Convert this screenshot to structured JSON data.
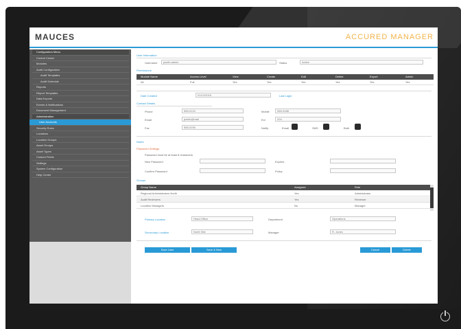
{
  "app": {
    "logo": "MAUCES",
    "title": "ACCURED MANAGER",
    "accent_color": "#2a9ad6",
    "title_color": "#f2b34a"
  },
  "sidebar": {
    "items": [
      {
        "label": "Configuration Menu",
        "kind": "head"
      },
      {
        "label": "Control Center",
        "kind": "normal"
      },
      {
        "label": "Modules",
        "kind": "normal"
      },
      {
        "label": "Audit Configuration",
        "kind": "normal"
      },
      {
        "label": "Audit Templates",
        "kind": "indent"
      },
      {
        "label": "Audit Schedule",
        "kind": "indent"
      },
      {
        "label": "Reports",
        "kind": "normal"
      },
      {
        "label": "Report Templates",
        "kind": "normal"
      },
      {
        "label": "Data Exports",
        "kind": "normal"
      },
      {
        "label": "Events & Notifications",
        "kind": "normal"
      },
      {
        "label": "Document Management",
        "kind": "normal"
      },
      {
        "label": "Administration",
        "kind": "head"
      },
      {
        "label": "User Accounts",
        "kind": "active"
      },
      {
        "label": "Security Roles",
        "kind": "normal"
      },
      {
        "label": "Locations",
        "kind": "normal"
      },
      {
        "label": "Location Groups",
        "kind": "normal"
      },
      {
        "label": "Asset Groups",
        "kind": "normal"
      },
      {
        "label": "Asset Types",
        "kind": "normal"
      },
      {
        "label": "Custom Fields",
        "kind": "normal"
      },
      {
        "label": "Settings",
        "kind": "normal"
      },
      {
        "label": "System Configuration",
        "kind": "normal"
      },
      {
        "label": "Help Center",
        "kind": "normal"
      }
    ]
  },
  "main": {
    "section_title": "User Information",
    "username_label": "Username",
    "username_value": "jsmith.admin",
    "status_label": "Status",
    "status_value": "Active",
    "permissions_label": "Permissions",
    "grid1": {
      "headers": [
        "Module Name",
        "Access Level",
        "View",
        "Create",
        "Edit",
        "Delete",
        "Export",
        "Admin"
      ],
      "rows": [
        [
          "All",
          "Full",
          "Yes",
          "Yes",
          "Yes",
          "Yes",
          "Yes",
          "Yes"
        ]
      ]
    },
    "date_created_label": "Date Created",
    "date_created_value": "01/12/2015",
    "last_login_label": "Last Login",
    "contact_title": "Contact Details",
    "phone_label": "Phone",
    "phone_value": "555-0123",
    "mobile_label": "Mobile",
    "mobile_value": "555-0188",
    "email_label": "Email",
    "email_value": "jsmith@mail",
    "ext_label": "Ext",
    "ext_value": "204",
    "fax_label": "Fax",
    "fax_value": "555-0190",
    "notify_label": "Notify",
    "notify_options": [
      "Email",
      "SMS",
      "Both"
    ],
    "notes_title": "Notes",
    "password_title": "Password Settings",
    "password_hint": "Password must be at least 8 characters",
    "new_password_label": "New Password",
    "confirm_password_label": "Confirm Password",
    "expires_label": "Expires",
    "policy_label": "Policy",
    "groups_title": "Groups",
    "grid2": {
      "headers": [
        "Group Name",
        "Assigned",
        "Role"
      ],
      "rows": [
        [
          "Regional Administrators North",
          "Yes",
          "Administrator"
        ],
        [
          "Audit Reviewers",
          "Yes",
          "Reviewer"
        ],
        [
          "Location Managers",
          "No",
          "Manager"
        ]
      ]
    },
    "primary_location_label": "Primary Location",
    "primary_location_value": "Head Office",
    "department_label": "Department",
    "department_value": "Operations",
    "secondary_location_label": "Secondary Location",
    "secondary_location_value": "North Site",
    "manager_label": "Manager",
    "manager_value": "R. Jones",
    "buttons": {
      "save": "Save User",
      "save_new": "Save & New",
      "cancel": "Cancel",
      "delete": "Delete"
    }
  }
}
